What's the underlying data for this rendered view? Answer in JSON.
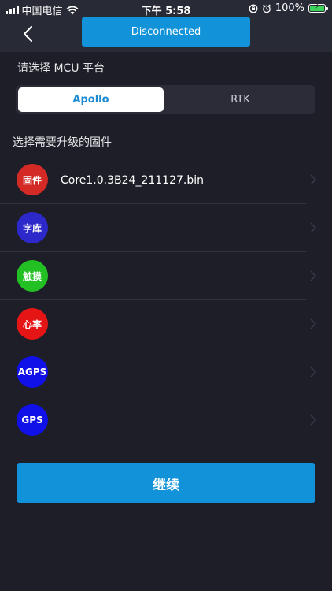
{
  "status_bar": {
    "carrier": "中国电信",
    "time": "下午 5:58",
    "battery": "100%"
  },
  "header": {
    "title": "Disconnected"
  },
  "mcu": {
    "label": "请选择 MCU 平台",
    "options": [
      "Apollo",
      "RTK"
    ],
    "selected": "Apollo"
  },
  "firmware": {
    "label": "选择需要升级的固件",
    "items": [
      {
        "badge": "固件",
        "color": "#d42a26",
        "file": "Core1.0.3B24_211127.bin"
      },
      {
        "badge": "字库",
        "color": "#2d28c9",
        "file": ""
      },
      {
        "badge": "触摸",
        "color": "#23c024",
        "file": ""
      },
      {
        "badge": "心率",
        "color": "#e61515",
        "file": ""
      },
      {
        "badge": "AGPS",
        "color": "#1010e8",
        "file": ""
      },
      {
        "badge": "GPS",
        "color": "#1010e8",
        "file": ""
      }
    ]
  },
  "continue_label": "继续",
  "colors": {
    "accent": "#1293d9",
    "background": "#1d1e27",
    "topbar": "#282a35"
  }
}
